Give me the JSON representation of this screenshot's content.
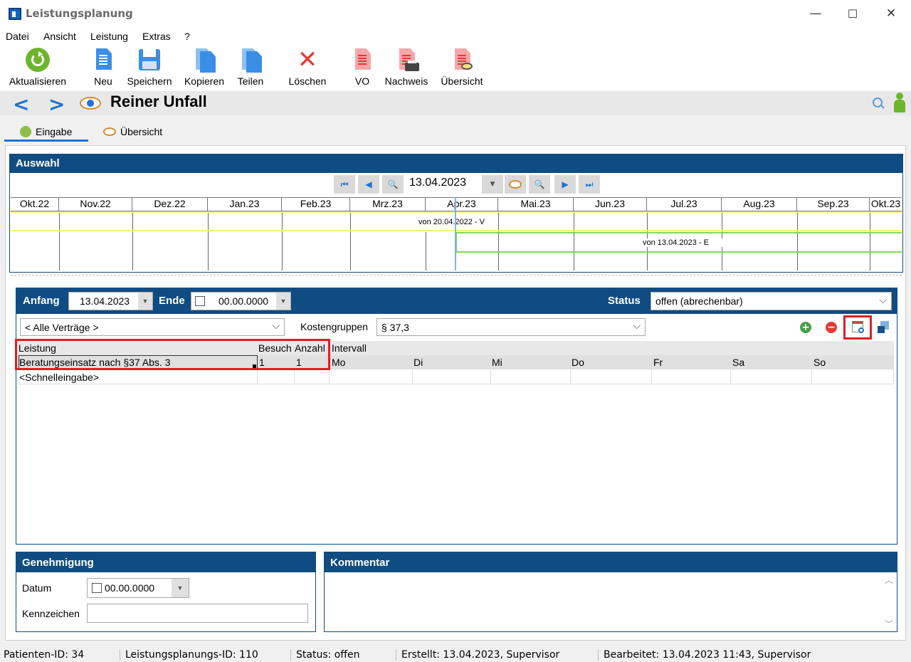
{
  "window": {
    "title": "Leistungsplanung",
    "minimize": "—",
    "maximize": "☐",
    "close": "✕"
  },
  "menu": [
    "Datei",
    "Ansicht",
    "Leistung",
    "Extras",
    "?"
  ],
  "toolbar": {
    "refresh": "Aktualisieren",
    "new": "Neu",
    "save": "Speichern",
    "copy": "Kopieren",
    "share": "Teilen",
    "delete": "Löschen",
    "vo": "VO",
    "proof": "Nachweis",
    "overview": "Übersicht"
  },
  "nav": {
    "title": "Reiner Unfall"
  },
  "tabs": [
    {
      "label": "Eingabe"
    },
    {
      "label": "Übersicht"
    }
  ],
  "auswahl": {
    "header": "Auswahl",
    "date": "13.04.2023",
    "months": [
      "Okt.22",
      "Nov.22",
      "Dez.22",
      "Jan.23",
      "Feb.23",
      "Mrz.23",
      "Apr.23",
      "Mai.23",
      "Jun.23",
      "Jul.23",
      "Aug.23",
      "Sep.23",
      "Okt.23"
    ],
    "bar1_label": "von 20.04.2022 - V",
    "bar2_label": "von 13.04.2023 - E"
  },
  "form": {
    "anfang_label": "Anfang",
    "anfang_value": "13.04.2023",
    "ende_label": "Ende",
    "ende_value": "00.00.0000",
    "status_label": "Status",
    "status_value": "offen (abrechenbar)",
    "vertraege_value": "< Alle Verträge >",
    "kostengruppen_label": "Kostengruppen",
    "kostengruppen_value": "§ 37,3"
  },
  "grid": {
    "col_leistung": "Leistung",
    "col_besuch": "Besuch",
    "col_anzahl": "Anzahl",
    "col_intervall": "Intervall",
    "days": [
      "Mo",
      "Di",
      "Mi",
      "Do",
      "Fr",
      "Sa",
      "So"
    ],
    "row1": {
      "leistung": "Beratungseinsatz nach §37 Abs. 3",
      "besuch": "1",
      "anzahl": "1"
    },
    "quick": "<Schnelleingabe>"
  },
  "genehmigung": {
    "header": "Genehmigung",
    "datum_label": "Datum",
    "datum_value": "00.00.0000",
    "kennzeichen_label": "Kennzeichen"
  },
  "kommentar": {
    "header": "Kommentar"
  },
  "status": {
    "patient": "Patienten-ID: 34",
    "plan": "Leistungsplanungs-ID: 110",
    "state": "Status: offen",
    "created": "Erstellt: 13.04.2023, Supervisor",
    "edited": "Bearbeitet: 13.04.2023 11:43, Supervisor"
  }
}
